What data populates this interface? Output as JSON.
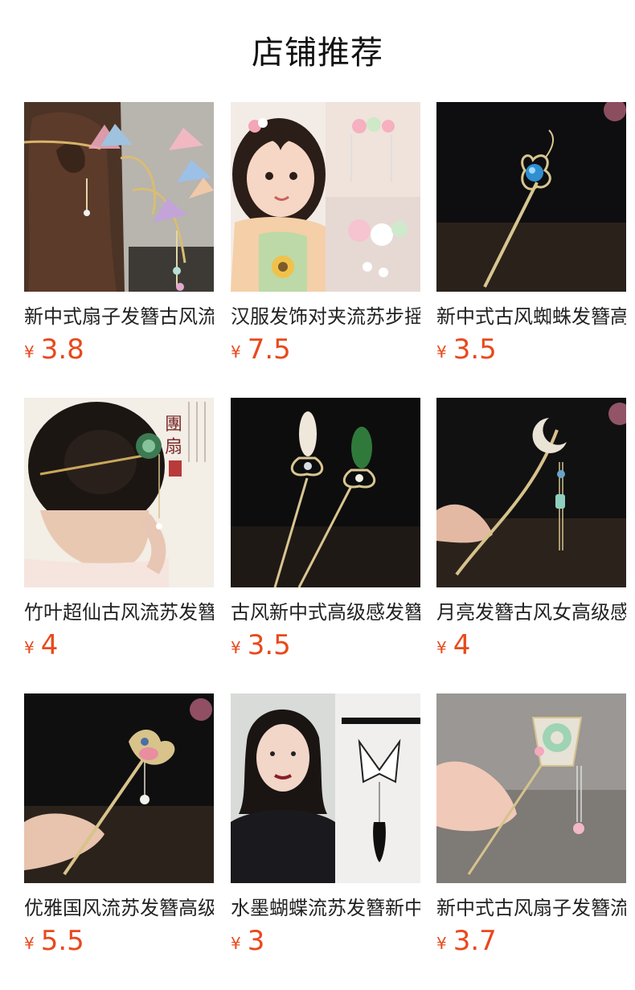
{
  "page": {
    "title": "店铺推荐"
  },
  "products": [
    {
      "name": "新中式扇子发簪古风流苏",
      "currency": "¥",
      "price": "3.8",
      "theme": "hair-fan"
    },
    {
      "name": "汉服发饰对夹流苏步摇",
      "currency": "¥",
      "price": "7.5",
      "theme": "child-flowers"
    },
    {
      "name": "新中式古风蜘蛛发簪高级",
      "currency": "¥",
      "price": "3.5",
      "theme": "dark-blue-gem"
    },
    {
      "name": "竹叶超仙古风流苏发簪",
      "currency": "¥",
      "price": "4",
      "theme": "bun-bamboo"
    },
    {
      "name": "古风新中式高级感发簪",
      "currency": "¥",
      "price": "3.5",
      "theme": "dark-pearl-jade"
    },
    {
      "name": "月亮发簪古风女高级感",
      "currency": "¥",
      "price": "4",
      "theme": "dark-moon"
    },
    {
      "name": "优雅国风流苏发簪高级感",
      "currency": "¥",
      "price": "5.5",
      "theme": "dark-pink-flower"
    },
    {
      "name": "水墨蝴蝶流苏发簪新中式",
      "currency": "¥",
      "price": "3",
      "theme": "butterfly-ink"
    },
    {
      "name": "新中式古风扇子发簪流苏",
      "currency": "¥",
      "price": "3.7",
      "theme": "jade-fan"
    }
  ]
}
